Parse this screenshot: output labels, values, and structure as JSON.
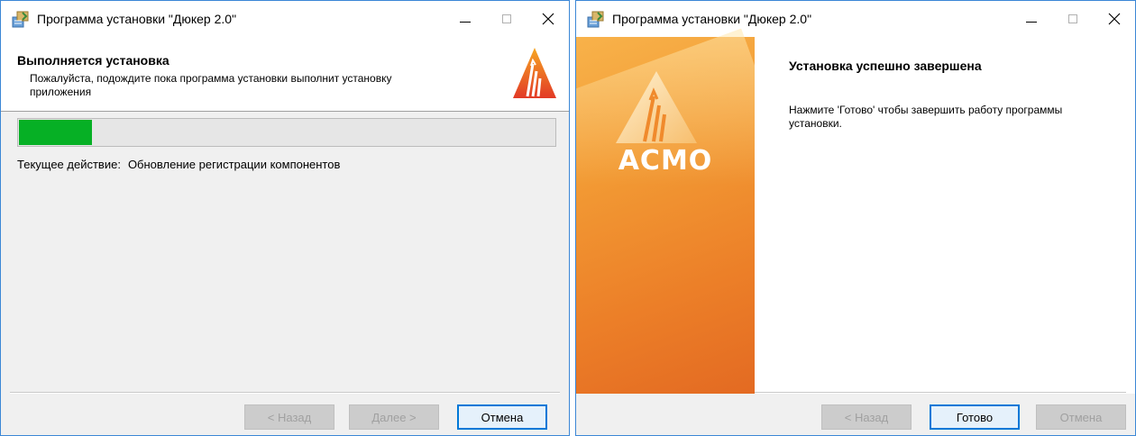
{
  "window1": {
    "title": "Программа установки \"Дюкер 2.0\"",
    "heading": "Выполняется установка",
    "subtitle": "Пожалуйста, подождите пока программа установки выполнит установку приложения",
    "progress_percent": 14,
    "progress_color": "#06b025",
    "current_action_label": "Текущее действие:",
    "current_action_value": "Обновление регистрации компонентов",
    "buttons": {
      "back": "< Назад",
      "next": "Далее >",
      "cancel": "Отмена"
    }
  },
  "window2": {
    "title": "Программа установки \"Дюкер 2.0\"",
    "brand": "АСМО",
    "heading": "Установка успешно завершена",
    "message": "Нажмите 'Готово' чтобы завершить работу программы установки.",
    "buttons": {
      "back": "< Назад",
      "finish": "Готово",
      "cancel": "Отмена"
    }
  },
  "colors": {
    "accent_border": "#3b87d6",
    "brand_orange": "#ec7f28",
    "logo_red": "#e8452a"
  },
  "icons": {
    "app": "installer-package-icon",
    "minimize": "minimize-icon",
    "maximize": "maximize-icon",
    "close": "close-icon",
    "logo": "asmo-logo-icon"
  }
}
